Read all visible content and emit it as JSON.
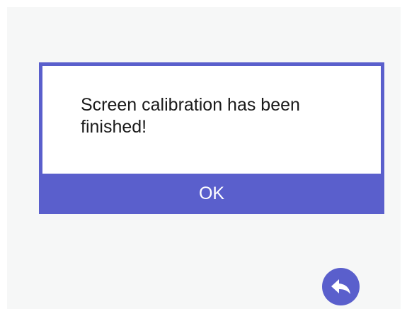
{
  "dialog": {
    "message": "Screen calibration has been finished!",
    "ok_label": "OK"
  },
  "nav": {
    "back_icon": "back-arrow-icon"
  },
  "colors": {
    "accent": "#5a5fcc",
    "screen_background": "#f6f7f7",
    "dialog_background": "#ffffff",
    "text": "#1a1a1a"
  }
}
